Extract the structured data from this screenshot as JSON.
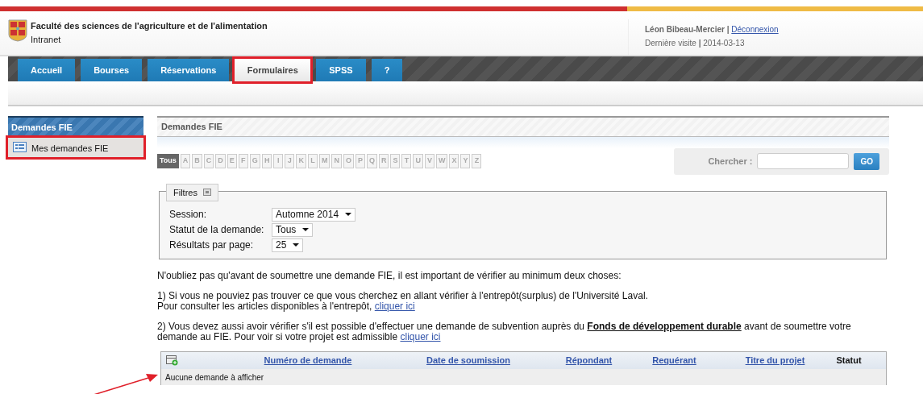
{
  "header": {
    "faculty": "Faculté des sciences de l'agriculture et de l'alimentation",
    "subtitle": "Intranet",
    "user": "Léon Bibeau-Mercier",
    "separator": "|",
    "logout": "Déconnexion",
    "last_visit_label": "Dernière visite",
    "last_visit_separator": "|",
    "last_visit": "2014-03-13"
  },
  "tabs": [
    {
      "label": "Accueil",
      "selected": false,
      "highlighted": false
    },
    {
      "label": "Bourses",
      "selected": false,
      "highlighted": false
    },
    {
      "label": "Réservations",
      "selected": false,
      "highlighted": false
    },
    {
      "label": "Formulaires",
      "selected": true,
      "highlighted": true
    },
    {
      "label": "SPSS",
      "selected": false,
      "highlighted": false
    },
    {
      "label": "?",
      "selected": false,
      "highlighted": false
    }
  ],
  "sidebar": {
    "title": "Demandes FIE",
    "items": [
      {
        "label": "Mes demandes FIE",
        "highlighted": true
      }
    ]
  },
  "main": {
    "title": "Demandes FIE",
    "alphabet": [
      {
        "label": "Tous",
        "selected": true
      },
      {
        "label": "A",
        "selected": false
      },
      {
        "label": "B",
        "selected": false
      },
      {
        "label": "C",
        "selected": false
      },
      {
        "label": "D",
        "selected": false
      },
      {
        "label": "E",
        "selected": false
      },
      {
        "label": "F",
        "selected": false
      },
      {
        "label": "G",
        "selected": false
      },
      {
        "label": "H",
        "selected": false
      },
      {
        "label": "I",
        "selected": false
      },
      {
        "label": "J",
        "selected": false
      },
      {
        "label": "K",
        "selected": false
      },
      {
        "label": "L",
        "selected": false
      },
      {
        "label": "M",
        "selected": false
      },
      {
        "label": "N",
        "selected": false
      },
      {
        "label": "O",
        "selected": false
      },
      {
        "label": "P",
        "selected": false
      },
      {
        "label": "Q",
        "selected": false
      },
      {
        "label": "R",
        "selected": false
      },
      {
        "label": "S",
        "selected": false
      },
      {
        "label": "T",
        "selected": false
      },
      {
        "label": "U",
        "selected": false
      },
      {
        "label": "V",
        "selected": false
      },
      {
        "label": "W",
        "selected": false
      },
      {
        "label": "X",
        "selected": false
      },
      {
        "label": "Y",
        "selected": false
      },
      {
        "label": "Z",
        "selected": false
      }
    ],
    "search": {
      "label": "Chercher :",
      "button": "GO"
    },
    "filters": {
      "legend": "Filtres",
      "fields": [
        {
          "label": "Session:",
          "value": "Automne 2014"
        },
        {
          "label": "Statut de la demande:",
          "value": "Tous"
        },
        {
          "label": "Résultats par page:",
          "value": "25"
        }
      ]
    },
    "intro": "N'oubliez pas qu'avant de soumettre une demande FIE, il est important de vérifier au minimum deux choses:",
    "note1": {
      "line1": "1) Si vous ne pouviez pas trouver ce que vous cherchez en allant vérifier à l'entrepôt(surplus) de l'Université Laval.",
      "line2": "Pour consulter les articles disponibles à l'entrepôt,",
      "link": "cliquer ici"
    },
    "note2": {
      "before": "2) Vous devez aussi avoir vérifier s'il est possible d'effectuer une demande de subvention auprès du",
      "fund_link": "Fonds de développement durable",
      "after": "avant de soumettre votre demande au FIE. Pour voir si votre projet est admissible",
      "link": "cliquer ici"
    },
    "table": {
      "columns": [
        {
          "label": "Numéro de demande",
          "kind": "link"
        },
        {
          "label": "Date de soumission",
          "kind": "link"
        },
        {
          "label": "Répondant",
          "kind": "link"
        },
        {
          "label": "Requérant",
          "kind": "link"
        },
        {
          "label": "Titre du projet",
          "kind": "link"
        },
        {
          "label": "Statut",
          "kind": "text"
        }
      ],
      "empty": "Aucune demande à afficher"
    }
  },
  "annotation_arrow": true
}
